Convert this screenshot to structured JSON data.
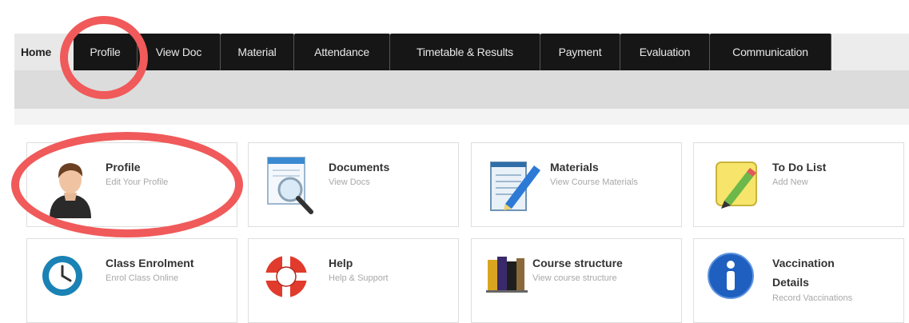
{
  "nav": {
    "tabs": [
      {
        "label": "Home"
      },
      {
        "label": "Profile"
      },
      {
        "label": "View Doc"
      },
      {
        "label": "Material"
      },
      {
        "label": "Attendance"
      },
      {
        "label": "Timetable & Results"
      },
      {
        "label": "Payment"
      },
      {
        "label": "Evaluation"
      },
      {
        "label": "Communication"
      }
    ]
  },
  "tiles": [
    {
      "title": "Profile",
      "subtitle": "Edit Your Profile",
      "icon": "user-avatar-icon"
    },
    {
      "title": "Documents",
      "subtitle": "View Docs",
      "icon": "document-magnifier-icon"
    },
    {
      "title": "Materials",
      "subtitle": "View Course Materials",
      "icon": "notepad-pencil-icon"
    },
    {
      "title": "To Do List",
      "subtitle": "Add New",
      "icon": "sticky-note-pencil-icon"
    },
    {
      "title": "Class Enrolment",
      "subtitle": "Enrol Class Online",
      "icon": "clock-icon"
    },
    {
      "title": "Help",
      "subtitle": "Help & Support",
      "icon": "lifebuoy-icon"
    },
    {
      "title": "Course structure",
      "subtitle": "View course structure",
      "icon": "books-icon"
    },
    {
      "title": "Vaccination",
      "title2": "Details",
      "subtitle": "Record Vaccinations",
      "icon": "info-icon"
    }
  ],
  "colors": {
    "tab_bg": "#161616",
    "highlight": "#f05a5a",
    "clock_ring": "#1a82b4",
    "info_blue": "#1f5fbf",
    "lifebuoy_red": "#e03b2c"
  }
}
